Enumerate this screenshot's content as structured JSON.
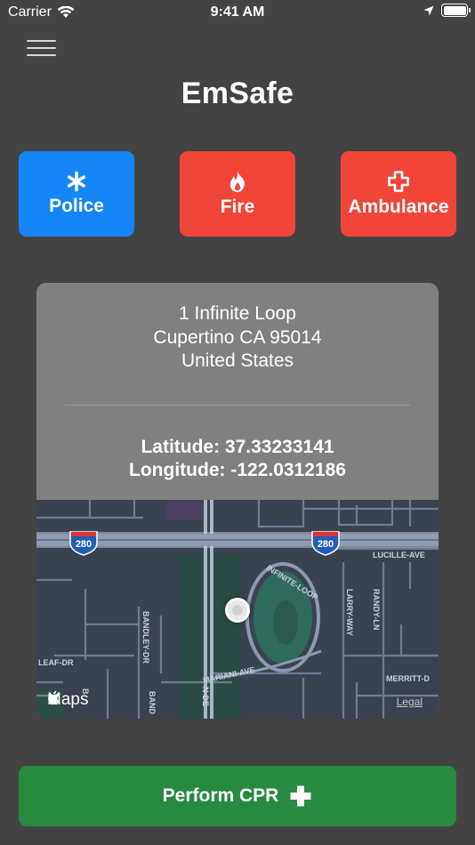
{
  "status_bar": {
    "carrier": "Carrier",
    "time": "9:41 AM"
  },
  "app": {
    "title": "EmSafe"
  },
  "services": {
    "police": "Police",
    "fire": "Fire",
    "ambulance": "Ambulance"
  },
  "location": {
    "address_line1": "1 Infinite Loop",
    "address_line2": "Cupertino CA 95014",
    "address_line3": "United States",
    "latitude_text": "Latitude:  37.33233141",
    "longitude_text": "Longitude:  -122.0312186"
  },
  "map": {
    "highway_label": "280",
    "street_labels": {
      "lucille": "LUCILLE-AVE",
      "infinite_loop": "INFINITE-LOOP",
      "larry_way": "LARRY-WAY",
      "randy_ln": "RANDY-LN",
      "bandley_dr": "BANDLEY-DR",
      "leaf_dr": "LEAF-DR",
      "mariani_ave": "MARIANI-AVE",
      "merritt": "MERRITT-D",
      "n_de": "N-DE",
      "banc": "BAND",
      "bc": "B"
    },
    "maps_label": "Maps",
    "legal_label": "Legal"
  },
  "cpr": {
    "label": "Perform CPR"
  },
  "colors": {
    "background": "#434343",
    "police": "#1486f5",
    "fire": "#f1453a",
    "ambulance": "#f1453a",
    "cpr": "#278a3f"
  }
}
